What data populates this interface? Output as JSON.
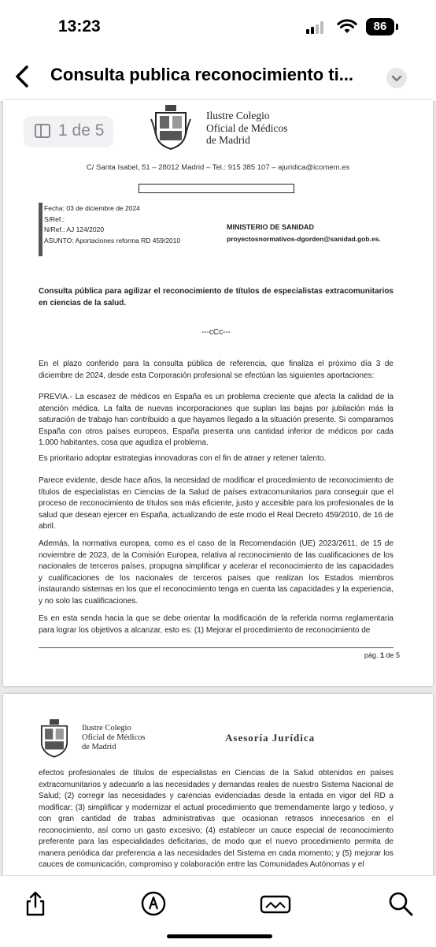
{
  "status_bar": {
    "time": "13:23",
    "battery": "86"
  },
  "nav": {
    "title": "Consulta publica reconocimiento ti..."
  },
  "page_indicator": "1 de 5",
  "letterhead": {
    "org_line1": "Ilustre Colegio",
    "org_line2": "Oficial de Médicos",
    "org_line3": "de Madrid",
    "address": "C/ Santa Isabel, 51 – 28012 Madrid – Tel.: 915 385 107 – ajuridica@icomem.es"
  },
  "meta": {
    "fecha": "Fecha: 03 de diciembre de 2024",
    "sref": "S/Ref.:",
    "nref": "N/Ref.: AJ 124/2020",
    "asunto": "ASUNTO: Aportaciones reforma RD 459/2010"
  },
  "recipient": {
    "name": "MINISTERIO DE SANIDAD",
    "email": "proyectosnormativos-dgorden@sanidad.gob.es."
  },
  "doc": {
    "title": "Consulta pública para agilizar el reconocimiento de títulos de especialistas extracomunitarios en ciencias de la salud.",
    "separator": "---cCc---",
    "p1": "En el plazo conferido para la consulta pública de referencia, que finaliza el próximo día 3 de diciembre de 2024, desde esta Corporación profesional se efectúan las siguientes aportaciones:",
    "p2": "PREVIA.- La escasez de médicos en España es un problema creciente que afecta la calidad de la atención médica. La falta de nuevas incorporaciones que suplan las bajas por jubilación más la saturación de trabajo han contribuido a que hayamos llegado a la situación presente. Si comparamos España con otros países europeos, España presenta una cantidad inferior de médicos por cada 1.000 habitantes, cosa que agudiza el problema.",
    "p3": "Es prioritario adoptar estrategias innovadoras con el fin de atraer y retener talento.",
    "p4": "Parece evidente, desde hace años, la necesidad de modificar el procedimiento de reconocimiento de títulos de especialistas en Ciencias de la Salud de países extracomunitarios para conseguir que el proceso de reconocimiento de títulos sea más eficiente, justo y accesible para los profesionales de la salud que desean ejercer en España, actualizando de este modo el Real Decreto 459/2010, de 16 de abril.",
    "p5": "Además, la normativa europea, como es el caso de la Recomendación (UE) 2023/2611, de 15 de noviembre de 2023, de la Comisión Europea, relativa al reconocimiento de las cualificaciones de los nacionales de terceros países, propugna simplificar y acelerar el reconocimiento de las capacidades y cualificaciones de los nacionales de terceros países que realizan los Estados miembros instaurando sistemas en los que el reconocimiento tenga en cuenta las capacidades y la experiencia, y no solo las cualificaciones.",
    "p6": "Es en esta senda hacia la que se debe orientar la modificación de la referida norma reglamentaria para lograr los objetivos a alcanzar, esto es: (1) Mejorar el procedimiento de reconocimiento de",
    "page_label": "pág. ",
    "page_current": "1",
    "page_total": " de 5"
  },
  "page2": {
    "header": "Asesoría Jurídica",
    "p1": "efectos profesionales de títulos de especialistas en Ciencias de la Salud obtenidos en países extracomunitarios y adecuarlo a las necesidades y demandas reales de nuestro Sistema Nacional de Salud; (2) corregir las necesidades y carencias evidenciadas desde la entada en vigor del RD a modificar; (3) simplificar y modernizar el actual procedimiento que tremendamente largo y tedioso, y con gran cantidad de trabas administrativas que ocasionan retrasos innecesarios en el reconocimiento, así como un gasto excesivo; (4) establecer un cauce especial de reconocimiento preferente para las especialidades deficitarias, de modo que el nuevo procedimiento permita de manera periódica dar preferencia a las necesidades del Sistema en cada momento; y (5) mejorar los cauces de comunicación, compromiso y colaboración entre las Comunidades Autónomas y el"
  },
  "toolbar": {
    "icons": [
      "share-icon",
      "markup-icon",
      "signature-icon",
      "search-icon"
    ]
  }
}
